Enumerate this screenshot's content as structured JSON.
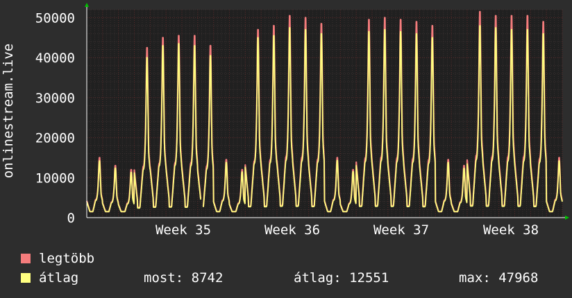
{
  "chart_data": {
    "type": "line",
    "ylabel": "onlinestream.live",
    "ylim": [
      0,
      52000
    ],
    "yticks": [
      0,
      10000,
      20000,
      30000,
      40000,
      50000
    ],
    "ytick_labels": [
      "0",
      "10000",
      "20000",
      "30000",
      "40000",
      "50000"
    ],
    "xlabels": [
      "Week 35",
      "Week 36",
      "Week 37",
      "Week 38"
    ],
    "days": 30,
    "gap_after_day": 7,
    "series": [
      {
        "name": "legtöbb",
        "color": "#f47c7c",
        "daily_peaks": [
          15000,
          13000,
          12000,
          42500,
          45000,
          45500,
          45500,
          43000,
          14500,
          12000,
          47000,
          48000,
          50500,
          50000,
          48500,
          15000,
          12000,
          49500,
          50000,
          49500,
          49000,
          48000,
          14500,
          13000,
          51500,
          50500,
          50500,
          50500,
          49000,
          15000,
          12000
        ]
      },
      {
        "name": "átlag",
        "color": "#ffff80",
        "daily_peaks": [
          14200,
          12400,
          11300,
          40000,
          43000,
          43500,
          43000,
          40500,
          13800,
          11400,
          45000,
          45500,
          47500,
          47000,
          46000,
          14300,
          11500,
          46500,
          47000,
          46500,
          46000,
          45000,
          13800,
          12300,
          48000,
          47500,
          47000,
          47000,
          46000,
          14200,
          11400
        ]
      }
    ],
    "grid": true
  },
  "legend": [
    {
      "label": "legtöbb",
      "color": "#f47c7c"
    },
    {
      "label": "átlag",
      "color": "#ffff80"
    }
  ],
  "stats": {
    "most": "most: 8742",
    "atlag": "átlag: 12551",
    "max": "max: 47968"
  },
  "colors": {
    "background": "#2d2d2d",
    "plot_background": "#202020",
    "grid_major": "#5a2a2a",
    "grid_minor": "#3a3030",
    "axis": "#ffffff",
    "arrow": "#00c000"
  }
}
